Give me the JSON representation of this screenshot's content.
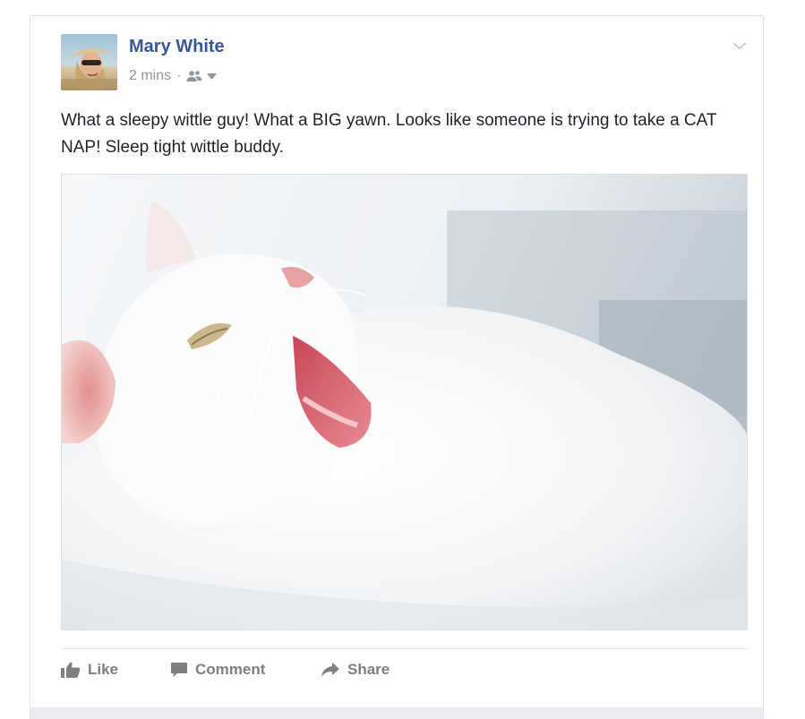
{
  "post": {
    "author": "Mary White",
    "timestamp": "2 mins",
    "separator": "·",
    "audience_icon": "friends-icon",
    "text": "What a sleepy wittle guy! What a BIG yawn. Looks like someone is trying to take a CAT NAP! Sleep tight wittle buddy.",
    "image_subject": "white-cat-yawning"
  },
  "actions": {
    "like_label": "Like",
    "comment_label": "Comment",
    "share_label": "Share"
  },
  "colors": {
    "author_link": "#365899",
    "body_text": "#1d2129",
    "meta_text": "#90949c",
    "action_text": "#7f7f7f"
  }
}
